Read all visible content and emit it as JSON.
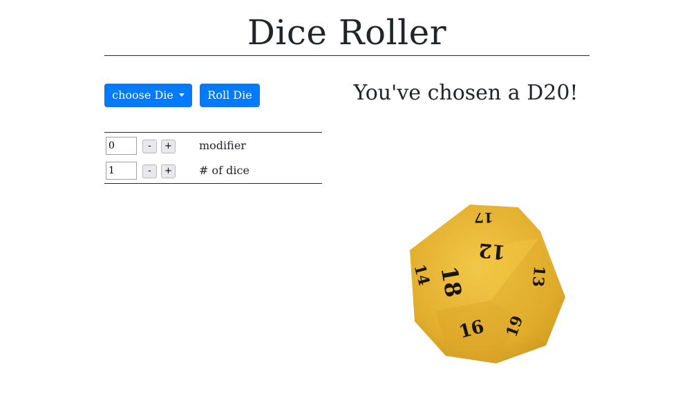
{
  "header": {
    "title": "Dice Roller"
  },
  "toolbar": {
    "choose_label": "choose Die",
    "roll_label": "Roll Die"
  },
  "controls": {
    "modifier": {
      "value": "0",
      "minus": "-",
      "plus": "+",
      "label": "modifier"
    },
    "dice_count": {
      "value": "1",
      "minus": "-",
      "plus": "+",
      "label": "# of dice"
    }
  },
  "result": {
    "message": "You've chosen a D20!"
  },
  "die_image": {
    "type": "d20",
    "color": "#e9b530",
    "faces": [
      "17",
      "12",
      "13",
      "14",
      "18",
      "16",
      "19"
    ]
  },
  "colors": {
    "primary": "#007bff",
    "text": "#212529"
  }
}
